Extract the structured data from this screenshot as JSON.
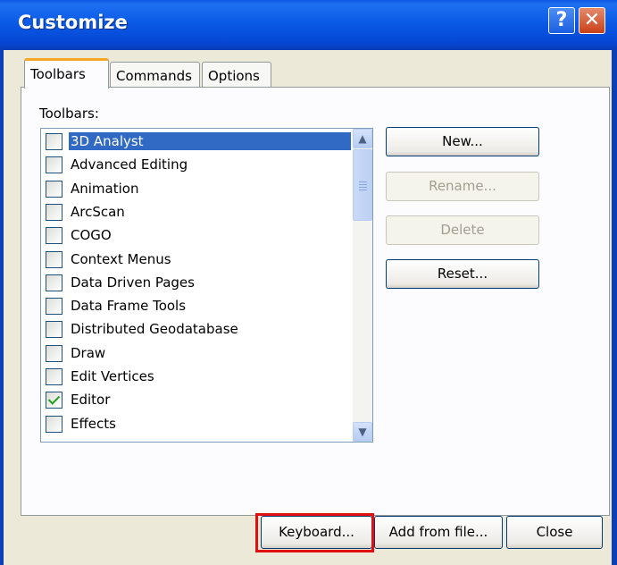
{
  "window": {
    "title": "Customize",
    "help_glyph": "?",
    "close_glyph": "✕"
  },
  "tabs": [
    {
      "label": "Toolbars",
      "active": true
    },
    {
      "label": "Commands",
      "active": false
    },
    {
      "label": "Options",
      "active": false
    }
  ],
  "toolbars_label": "Toolbars:",
  "toolbar_items": [
    {
      "label": "3D Analyst",
      "checked": false,
      "selected": true
    },
    {
      "label": "Advanced Editing",
      "checked": false,
      "selected": false
    },
    {
      "label": "Animation",
      "checked": false,
      "selected": false
    },
    {
      "label": "ArcScan",
      "checked": false,
      "selected": false
    },
    {
      "label": "COGO",
      "checked": false,
      "selected": false
    },
    {
      "label": "Context Menus",
      "checked": false,
      "selected": false
    },
    {
      "label": "Data Driven Pages",
      "checked": false,
      "selected": false
    },
    {
      "label": "Data Frame Tools",
      "checked": false,
      "selected": false
    },
    {
      "label": "Distributed Geodatabase",
      "checked": false,
      "selected": false
    },
    {
      "label": "Draw",
      "checked": false,
      "selected": false
    },
    {
      "label": "Edit Vertices",
      "checked": false,
      "selected": false
    },
    {
      "label": "Editor",
      "checked": true,
      "selected": false
    },
    {
      "label": "Effects",
      "checked": false,
      "selected": false
    }
  ],
  "scrollbar": {
    "up_glyph": "▲",
    "down_glyph": "▼"
  },
  "side_buttons": {
    "new": "New...",
    "rename": "Rename...",
    "delete": "Delete",
    "reset": "Reset..."
  },
  "bottom_buttons": {
    "keyboard": "Keyboard...",
    "add_from_file": "Add from file...",
    "close": "Close"
  },
  "colors": {
    "title_bar": "#0a57e6",
    "selection": "#316ac5",
    "highlight_box": "#e01010",
    "check_mark": "#21a121"
  }
}
